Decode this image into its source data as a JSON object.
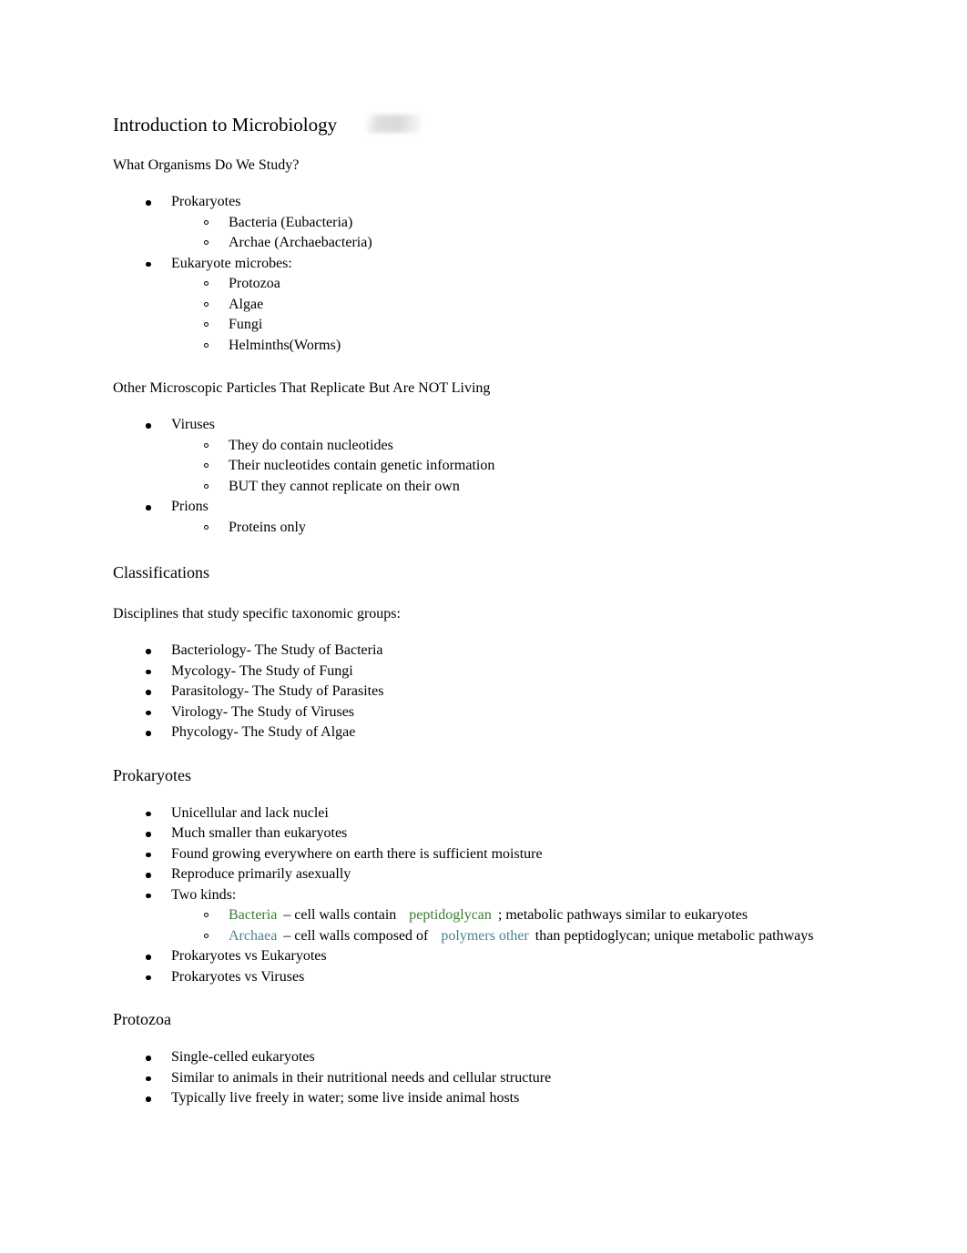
{
  "document": {
    "title": "Introduction to Microbiology",
    "colors": {
      "text": "#000000",
      "green": "#3c7a33",
      "teal": "#4a8390",
      "background": "#ffffff"
    },
    "sections": [
      {
        "heading": "What Organisms Do We Study?",
        "items": [
          {
            "label": "Prokaryotes",
            "children": [
              "Bacteria (Eubacteria)",
              "Archae (Archaebacteria)"
            ]
          },
          {
            "label": "Eukaryote microbes:",
            "children": [
              "Protozoa",
              "Algae",
              "Fungi",
              "Helminths(Worms)"
            ]
          }
        ]
      },
      {
        "heading": "Other Microscopic Particles That Replicate But Are NOT Living",
        "items": [
          {
            "label": "Viruses",
            "children": [
              "They do contain nucleotides",
              "Their nucleotides contain genetic information",
              "BUT they cannot replicate on their own"
            ]
          },
          {
            "label": "Prions",
            "children": [
              "Proteins only"
            ]
          }
        ]
      },
      {
        "heading": "Classifications",
        "intro": "Disciplines that study specific taxonomic groups:",
        "items": [
          {
            "label": "Bacteriology- The Study of Bacteria"
          },
          {
            "label": "Mycology- The Study of Fungi"
          },
          {
            "label": "Parasitology- The Study of Parasites"
          },
          {
            "label": "Virology- The Study of Viruses"
          },
          {
            "label": "Phycology- The Study of Algae"
          }
        ]
      },
      {
        "heading": "Prokaryotes",
        "items": [
          {
            "label": "Unicellular and lack nuclei"
          },
          {
            "label": "Much smaller than eukaryotes"
          },
          {
            "label": "Found growing everywhere on earth there is sufficient moisture"
          },
          {
            "label": "Reproduce primarily asexually"
          },
          {
            "label": "Two kinds:",
            "rich_children": [
              {
                "term": "Bacteria",
                "term_color": "green",
                "mid": "– cell walls contain",
                "highlight": "peptidoglycan",
                "highlight_color": "green",
                "tail": "; metabolic pathways similar to eukaryotes"
              },
              {
                "term": "Archaea",
                "term_color": "teal",
                "mid": "– cell walls composed of",
                "highlight": "polymers other",
                "highlight_color": "teal",
                "tail": "than peptidoglycan; unique metabolic pathways"
              }
            ]
          },
          {
            "label": "Prokaryotes vs Eukaryotes"
          },
          {
            "label": "Prokaryotes vs Viruses"
          }
        ]
      },
      {
        "heading": "Protozoa",
        "items": [
          {
            "label": "Single-celled eukaryotes"
          },
          {
            "label": "Similar to animals in their nutritional needs and cellular structure"
          },
          {
            "label": "Typically live freely in water; some live inside animal hosts"
          }
        ]
      }
    ]
  }
}
